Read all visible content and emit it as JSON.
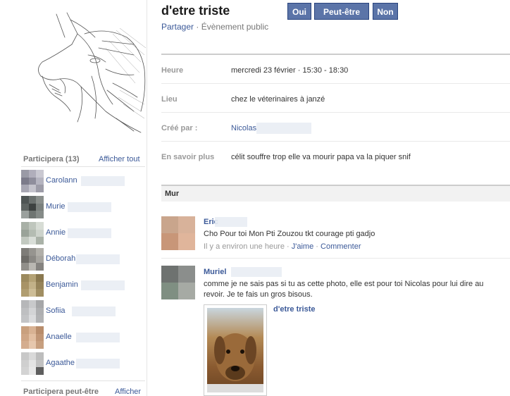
{
  "event": {
    "title": "d'etre triste",
    "buttons": {
      "yes": "Oui",
      "maybe": "Peut-être",
      "no": "Non"
    },
    "share": "Partager",
    "separator": "·",
    "visibility": "Évènement public"
  },
  "details": [
    {
      "label": "Heure",
      "value": "mercredi 23 février · 15:30 - 18:30"
    },
    {
      "label": "Lieu",
      "value": "chez le véterinaires à janzé"
    },
    {
      "label": "Créé par :",
      "value": "Nicolas"
    },
    {
      "label": "En savoir plus",
      "value": "célit souffre trop elle va mourir papa va la piquer snif"
    }
  ],
  "wall": {
    "title": "Mur",
    "posts": [
      {
        "author": "Eric",
        "text": "Cho Pour toi Mon Pti Zouzou tkt courage pti gadjo",
        "time": "Il y a environ une heure",
        "like": "J'aime",
        "comment": "Commenter",
        "thumb_colors": [
          "#c9a58c",
          "#d8b29a",
          "#c89678",
          "#e0b59b"
        ]
      },
      {
        "author": "Muriel",
        "text": "comme je ne sais pas si tu as cette photo, elle est pour toi Nicolas pour lui dire au revoir. Je te fais un gros bisous.",
        "attachment_title": "d'etre triste",
        "thumb_colors": [
          "#6e7270",
          "#8b8e8c",
          "#7f8f82",
          "#a6aaa4"
        ]
      }
    ]
  },
  "sidebar": {
    "attending_title": "Participera (13)",
    "show_all": "Afficher tout",
    "attendees": [
      {
        "name": "Carolann",
        "colors": [
          "#9a9aa6",
          "#b0aebb",
          "#c9c8d1",
          "#7c7b8a",
          "#8f8e9c",
          "#b5b4c0",
          "#a8a7b3",
          "#c4c3cc",
          "#9d9ca8"
        ]
      },
      {
        "name": "Murie",
        "colors": [
          "#4f5554",
          "#6b716f",
          "#8a8f8c",
          "#5e6462",
          "#3d4241",
          "#7a807d",
          "#9aa09d",
          "#6f7572",
          "#858b88"
        ]
      },
      {
        "name": "Annie",
        "colors": [
          "#a8b0a6",
          "#bfc6bd",
          "#d7dcd5",
          "#9aa399",
          "#b4bcb2",
          "#cdd3cb",
          "#c2c9c0",
          "#d9ded8",
          "#aab2a8"
        ]
      },
      {
        "name": "Déborah",
        "colors": [
          "#7e7c78",
          "#96948f",
          "#b1afa9",
          "#6e6c68",
          "#8a8884",
          "#a6a49f",
          "#918f8a",
          "#b9b7b2",
          "#858380"
        ]
      },
      {
        "name": "Benjamin",
        "colors": [
          "#9c8a5e",
          "#b4a275",
          "#8a784f",
          "#a89366",
          "#c2b188",
          "#96845a",
          "#b09d70",
          "#cdbd96",
          "#a08e62"
        ]
      },
      {
        "name": "Sofiia",
        "colors": [
          "#b6b7b9",
          "#c8c9cb",
          "#a6a7a9",
          "#bebfc1",
          "#d3d4d6",
          "#aeafb1",
          "#c3c4c6",
          "#dadbdd",
          "#b1b2b4"
        ]
      },
      {
        "name": "Anaelle",
        "colors": [
          "#c9a07e",
          "#d8b293",
          "#b88d6c",
          "#cfa686",
          "#e2bfa2",
          "#c09676",
          "#d4ad8f",
          "#e6c7ad",
          "#c79f7f"
        ]
      },
      {
        "name": "Agaathe",
        "colors": [
          "#c8c8c8",
          "#d9d9d9",
          "#bdbdbd",
          "#cfcfcf",
          "#e4e4e4",
          "#c2c2c2",
          "#d3d3d3",
          "#e8e8e8",
          "#5e5e5e"
        ]
      }
    ],
    "maybe_title": "Participera peut-être",
    "maybe_show_all": "Afficher"
  }
}
